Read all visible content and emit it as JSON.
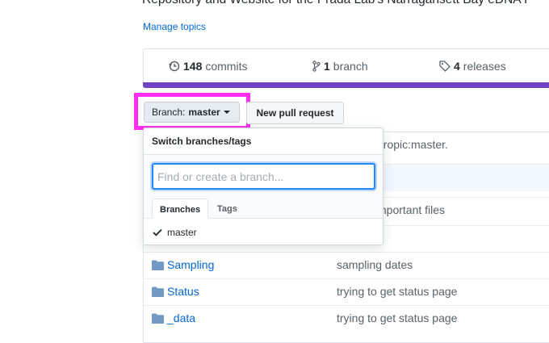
{
  "repo": {
    "description": "Repository and Website for the Prada Lab's Narragansett Bay eDNA P",
    "manage_topics": "Manage topics"
  },
  "summary": {
    "commits_count": "148",
    "commits_label": "commits",
    "branches_count": "1",
    "branches_label": "branch",
    "releases_count": "4",
    "releases_label": "releases",
    "language_bar_color": "#6f42c1"
  },
  "toolbar": {
    "branch_prefix": "Branch:",
    "branch_name": "master",
    "new_pr_label": "New pull request"
  },
  "branch_menu": {
    "title": "Switch branches/tags",
    "filter_placeholder": "Find or create a branch...",
    "tabs": [
      "Branches",
      "Tags"
    ],
    "active_tab": "Branches",
    "items": [
      {
        "name": "master",
        "selected": true
      }
    ]
  },
  "files": {
    "partial_messages": [
      "nropic:master.",
      "mportant files"
    ],
    "rows": [
      {
        "name": "Sampling",
        "message": "sampling dates"
      },
      {
        "name": "Status",
        "message": "trying to get status page"
      },
      {
        "name": "_data",
        "message": "trying to get status page"
      }
    ]
  },
  "colors": {
    "link": "#0366d6",
    "highlight_annotation": "#ff2ef2",
    "focus_ring": "#2188ff"
  }
}
